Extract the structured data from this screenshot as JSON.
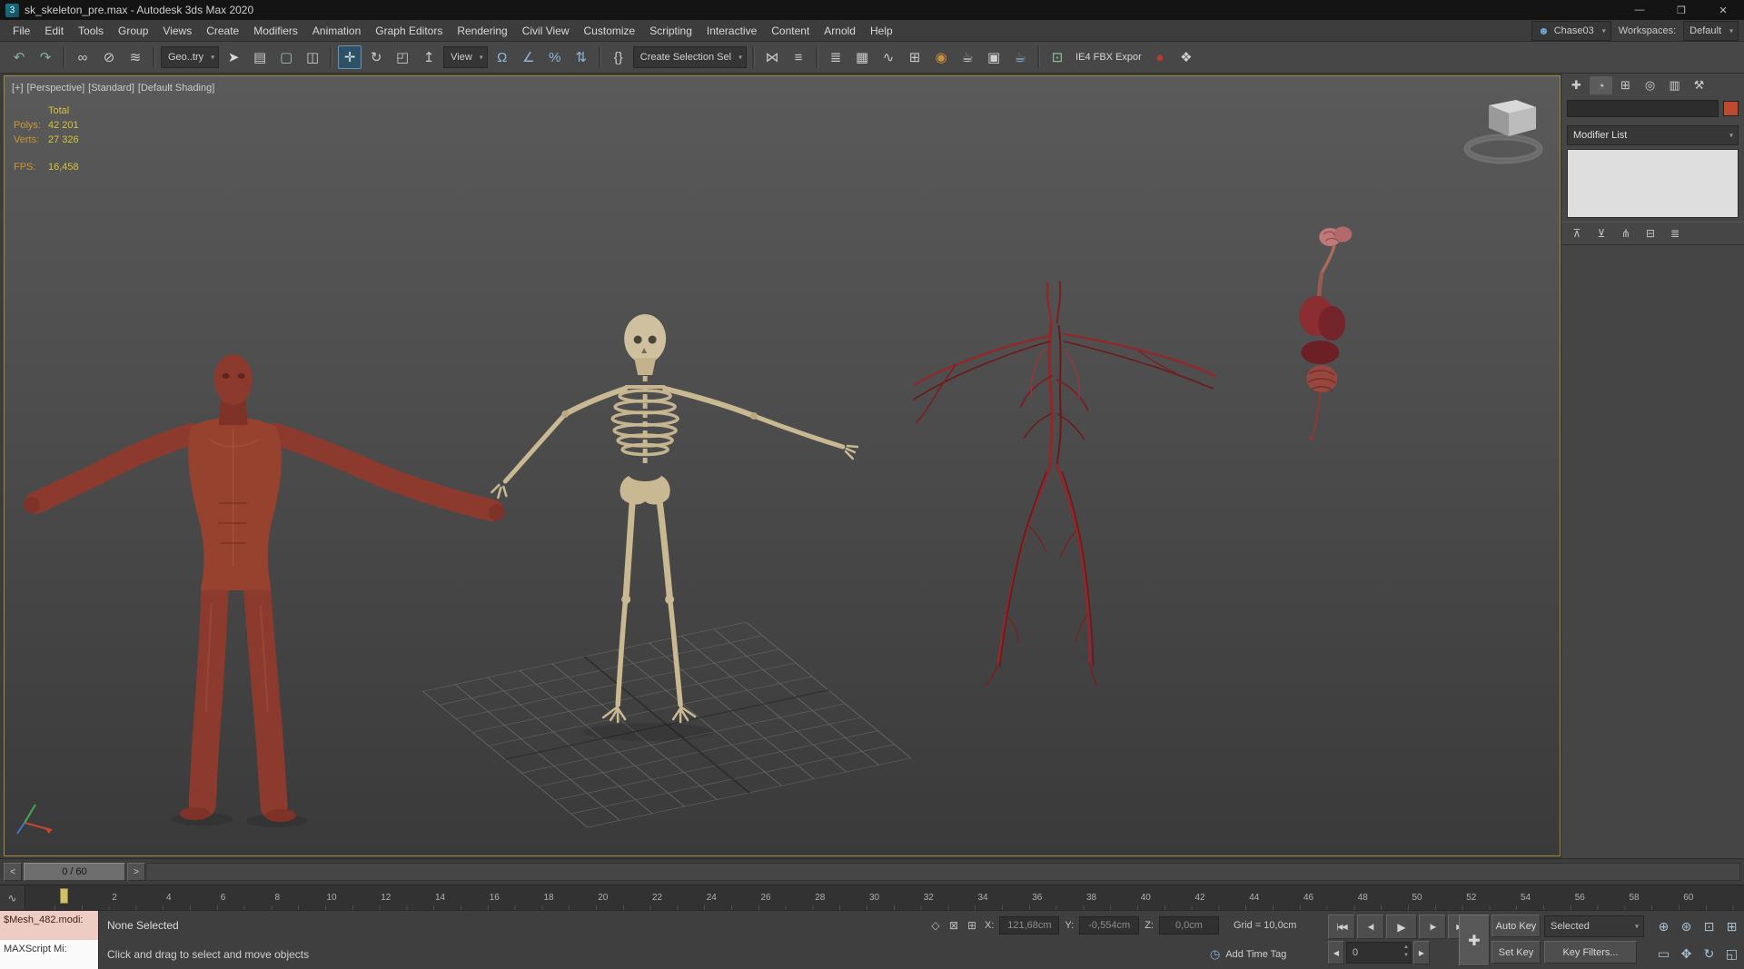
{
  "window": {
    "title": "sk_skeleton_pre.max - Autodesk 3ds Max 2020",
    "app_icon": "3",
    "minimize_glyph": "—",
    "maximize_glyph": "❐",
    "close_glyph": "✕"
  },
  "menu_bar": {
    "items": [
      "File",
      "Edit",
      "Tools",
      "Group",
      "Views",
      "Create",
      "Modifiers",
      "Animation",
      "Graph Editors",
      "Rendering",
      "Civil View",
      "Customize",
      "Scripting",
      "Interactive",
      "Content",
      "Arnold",
      "Help"
    ],
    "user_icon": "☻",
    "user_button": "Chase03",
    "workspaces_label": "Workspaces:",
    "workspace_selected": "Default"
  },
  "toolbar": {
    "items": [
      {
        "kind": "icon",
        "name": "undo-icon",
        "glyph": "↶",
        "tint": "#7fb2a6"
      },
      {
        "kind": "icon",
        "name": "redo-icon",
        "glyph": "↷",
        "tint": "#7fb2a6"
      },
      {
        "kind": "sep",
        "name": "toolbar-separator",
        "interactable": false
      },
      {
        "kind": "icon",
        "name": "select-link-icon",
        "glyph": "∞"
      },
      {
        "kind": "icon",
        "name": "unlink-selection-icon",
        "glyph": "⊘"
      },
      {
        "kind": "icon",
        "name": "bind-spacewarp-icon",
        "glyph": "≋"
      },
      {
        "kind": "sep",
        "name": "toolbar-separator",
        "interactable": false
      },
      {
        "kind": "dd",
        "name": "selection-filter-dropdown",
        "text": "Geo..try"
      },
      {
        "kind": "icon",
        "name": "select-object-icon",
        "glyph": "➤",
        "tint": "#d8d8d8"
      },
      {
        "kind": "icon",
        "name": "select-by-name-icon",
        "glyph": "▤"
      },
      {
        "kind": "icon",
        "name": "selection-region-icon",
        "glyph": "▢",
        "tint": "#8fc3bd"
      },
      {
        "kind": "icon",
        "name": "window-crossing-icon",
        "glyph": "◫"
      },
      {
        "kind": "sep",
        "name": "toolbar-separator",
        "interactable": false
      },
      {
        "kind": "icon",
        "name": "select-move-icon",
        "glyph": "✛",
        "active": true
      },
      {
        "kind": "icon",
        "name": "select-rotate-icon",
        "glyph": "↻"
      },
      {
        "kind": "icon",
        "name": "select-scale-icon",
        "glyph": "◰"
      },
      {
        "kind": "icon",
        "name": "select-placement-icon",
        "glyph": "↥"
      },
      {
        "kind": "dd",
        "name": "reference-coordinate-dropdown",
        "text": "View"
      },
      {
        "kind": "icon",
        "name": "snap-toggle-icon",
        "glyph": "Ω",
        "tint": "#8fb6d9"
      },
      {
        "kind": "icon",
        "name": "angle-snap-icon",
        "glyph": "∠",
        "tint": "#8fb6d9"
      },
      {
        "kind": "icon",
        "name": "percent-snap-icon",
        "glyph": "%",
        "tint": "#8fb6d9"
      },
      {
        "kind": "icon",
        "name": "spinner-snap-icon",
        "glyph": "⇅",
        "tint": "#8fb6d9"
      },
      {
        "kind": "sep",
        "name": "toolbar-separator",
        "interactable": false
      },
      {
        "kind": "icon",
        "name": "named-selection-sets-icon",
        "glyph": "{}"
      },
      {
        "kind": "dd",
        "name": "create-selection-set-dropdown",
        "text": "Create Selection Sel"
      },
      {
        "kind": "sep",
        "name": "toolbar-separator",
        "interactable": false
      },
      {
        "kind": "icon",
        "name": "mirror-icon",
        "glyph": "⋈"
      },
      {
        "kind": "icon",
        "name": "align-icon",
        "glyph": "≡"
      },
      {
        "kind": "sep",
        "name": "toolbar-separator",
        "interactable": false
      },
      {
        "kind": "icon",
        "name": "layer-manager-icon",
        "glyph": "≣"
      },
      {
        "kind": "icon",
        "name": "toggle-ribbon-icon",
        "glyph": "▦"
      },
      {
        "kind": "icon",
        "name": "curve-editor-icon",
        "glyph": "∿"
      },
      {
        "kind": "icon",
        "name": "schematic-view-icon",
        "glyph": "⊞"
      },
      {
        "kind": "icon",
        "name": "material-editor-icon",
        "glyph": "◉",
        "tint": "#c9913f"
      },
      {
        "kind": "icon",
        "name": "render-setup-icon",
        "glyph": "☕",
        "tint": "#cfcfcf"
      },
      {
        "kind": "icon",
        "name": "rendered-frame-icon",
        "glyph": "▣",
        "tint": "#cfcfcf"
      },
      {
        "kind": "icon",
        "name": "render-production-icon",
        "glyph": "☕",
        "tint": "#86b7dc"
      },
      {
        "kind": "sep",
        "name": "toolbar-separator",
        "interactable": false
      },
      {
        "kind": "icon",
        "name": "plugin-export-icon",
        "glyph": "⊡",
        "tint": "#8fc98f"
      },
      {
        "kind": "label",
        "name": "fbx-export-label",
        "text": "IE4 FBX Expor",
        "interactable": false
      },
      {
        "kind": "icon",
        "name": "substance-plugin-icon",
        "glyph": "●",
        "tint": "#c0392b"
      },
      {
        "kind": "icon",
        "name": "plugin-misc-icon",
        "glyph": "❖",
        "tint": "#cfcfcf"
      }
    ]
  },
  "viewport": {
    "label_plus": "[+]",
    "label_camera": "[Perspective]",
    "label_style": "[Standard]",
    "label_shading": "[Default Shading]",
    "stats": {
      "total_label": "Total",
      "polys_label": "Polys:",
      "polys_value": "42 201",
      "verts_label": "Verts:",
      "verts_value": "27 326",
      "fps_label": "FPS:",
      "fps_value": "16,458"
    }
  },
  "command_panel": {
    "tabs": [
      {
        "name": "tab-create",
        "glyph": "✚"
      },
      {
        "name": "tab-modify",
        "glyph": "◔",
        "active": true
      },
      {
        "name": "tab-hierarchy",
        "glyph": "⊞"
      },
      {
        "name": "tab-motion",
        "glyph": "◎"
      },
      {
        "name": "tab-display",
        "glyph": "▥"
      },
      {
        "name": "tab-utilities",
        "glyph": "⚒"
      }
    ],
    "modifier_list": "Modifier List",
    "stack_buttons": [
      {
        "name": "pin-stack-button",
        "glyph": "⊼"
      },
      {
        "name": "show-end-result-button",
        "glyph": "⊻"
      },
      {
        "name": "make-unique-button",
        "glyph": "⋔"
      },
      {
        "name": "remove-modifier-button",
        "glyph": "⊟"
      },
      {
        "name": "configure-modifier-sets-button",
        "glyph": "≣"
      }
    ]
  },
  "time_slider": {
    "left_arrow": "<",
    "value": "0 / 60",
    "right_arrow": ">"
  },
  "ruler": {
    "mini_button_glyph": "∿",
    "ticks": [
      "2",
      "4",
      "6",
      "8",
      "10",
      "12",
      "14",
      "16",
      "18",
      "20",
      "22",
      "24",
      "26",
      "28",
      "30",
      "32",
      "34",
      "36",
      "38",
      "40",
      "42",
      "44",
      "46",
      "48",
      "50",
      "52",
      "54",
      "56",
      "58",
      "60"
    ]
  },
  "status_bar": {
    "macro_line": "$Mesh_482.modi:",
    "listener_line": "MAXScript Mi:",
    "selection_status": "None Selected",
    "prompt": "Click and drag to select and move objects",
    "coord_icons": [
      {
        "name": "isolate-selection-icon",
        "glyph": "◇"
      },
      {
        "name": "selection-lock-icon",
        "glyph": "⊠"
      },
      {
        "name": "relative-absolute-icon",
        "glyph": "⊞"
      }
    ],
    "coords": {
      "x_label": "X:",
      "x_value": "121,68cm",
      "y_label": "Y:",
      "y_value": "-0,554cm",
      "z_label": "Z:",
      "z_value": "0,0cm"
    },
    "grid_label": "Grid = 10,0cm",
    "timetag_icon": "◷",
    "add_time_tag": "Add Time Tag",
    "playback": [
      {
        "name": "go-to-start-button",
        "glyph": "|◀◀"
      },
      {
        "name": "previous-frame-button",
        "glyph": "◀|"
      },
      {
        "name": "play-button",
        "glyph": "▶",
        "kind": "play"
      },
      {
        "name": "next-frame-button",
        "glyph": "|▶"
      },
      {
        "name": "go-to-end-button",
        "glyph": "▶▶|"
      }
    ],
    "frame_prev": "◀",
    "frame_value": "0",
    "frame_next": "▶",
    "spin_up": "▲",
    "spin_down": "▼",
    "set_keys_glyph": "✚",
    "auto_key": "Auto Key",
    "set_key": "Set Key",
    "filter_dropdown": "Selected",
    "key_filters": "Key Filters...",
    "nav_row1": [
      {
        "name": "zoom-icon",
        "glyph": "⊕"
      },
      {
        "name": "zoom-all-icon",
        "glyph": "⊛"
      },
      {
        "name": "zoom-extents-icon",
        "glyph": "⊡"
      },
      {
        "name": "zoom-extents-all-icon",
        "glyph": "⊞"
      }
    ],
    "nav_row2": [
      {
        "name": "zoom-region-icon",
        "glyph": "▭"
      },
      {
        "name": "pan-icon",
        "glyph": "✥"
      },
      {
        "name": "orbit-icon",
        "glyph": "↻"
      },
      {
        "name": "maximize-viewport-icon",
        "glyph": "◱"
      }
    ]
  },
  "colors": {
    "viewport_border": "#a18a39",
    "stats_label": "#c9972f",
    "stats_value": "#d6c23a",
    "macro_pink": "#edccc4",
    "swatch_red": "#bf4a2e",
    "accent_blue": "#2e5165"
  }
}
